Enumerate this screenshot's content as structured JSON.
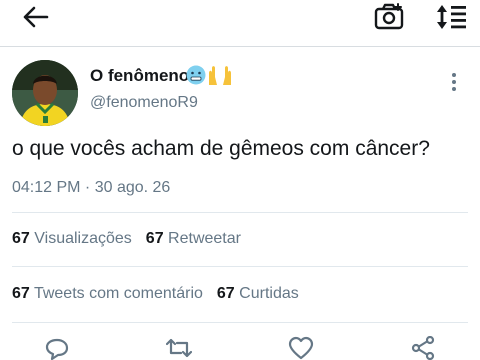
{
  "header": {
    "back_icon": "arrow-left-icon",
    "camera_icon": "camera-icon",
    "sort_icon": "sort-arrows-icon"
  },
  "tweet": {
    "display_name": "O fenômeno",
    "handle": "@fenomenoR9",
    "emojis": [
      "cold-face-emoji",
      "raising-hands-emoji"
    ],
    "text": "o que vocês acham de gêmeos com câncer?",
    "timestamp": "04:12 PM · 30 ago. 26"
  },
  "stats": {
    "views_count": "67",
    "views_label": "Visualizações",
    "retweets_count": "67",
    "retweets_label": "Retweetar",
    "quotes_count": "67",
    "quotes_label": "Tweets com comentário",
    "likes_count": "67",
    "likes_label": "Curtidas"
  },
  "actions": [
    "reply-icon",
    "retweet-icon",
    "like-icon",
    "share-icon"
  ],
  "colors": {
    "text": "#14171a",
    "secondary": "#657786",
    "divider": "#e1e8ed"
  }
}
